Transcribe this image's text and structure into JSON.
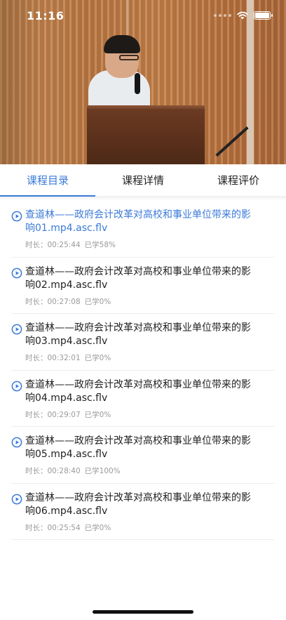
{
  "status_bar": {
    "time": "11:16"
  },
  "tabs": [
    {
      "label": "课程目录",
      "active": true
    },
    {
      "label": "课程详情",
      "active": false
    },
    {
      "label": "课程评价",
      "active": false
    }
  ],
  "accent_color": "#3b7ad9",
  "duration_label": "时长：",
  "courses": [
    {
      "title": "查道林——政府会计改革对高校和事业单位带来的影响01.mp4.asc.flv",
      "duration": "00:25:44",
      "progress": "已学58%",
      "current": true
    },
    {
      "title": "查道林——政府会计改革对高校和事业单位带来的影响02.mp4.asc.flv",
      "duration": "00:27:08",
      "progress": "已学0%",
      "current": false
    },
    {
      "title": "查道林——政府会计改革对高校和事业单位带来的影响03.mp4.asc.flv",
      "duration": "00:32:01",
      "progress": "已学0%",
      "current": false
    },
    {
      "title": "查道林——政府会计改革对高校和事业单位带来的影响04.mp4.asc.flv",
      "duration": "00:29:07",
      "progress": "已学0%",
      "current": false
    },
    {
      "title": "查道林——政府会计改革对高校和事业单位带来的影响05.mp4.asc.flv",
      "duration": "00:28:40",
      "progress": "已学100%",
      "current": false
    },
    {
      "title": "查道林——政府会计改革对高校和事业单位带来的影响06.mp4.asc.flv",
      "duration": "00:25:54",
      "progress": "已学0%",
      "current": false
    }
  ]
}
